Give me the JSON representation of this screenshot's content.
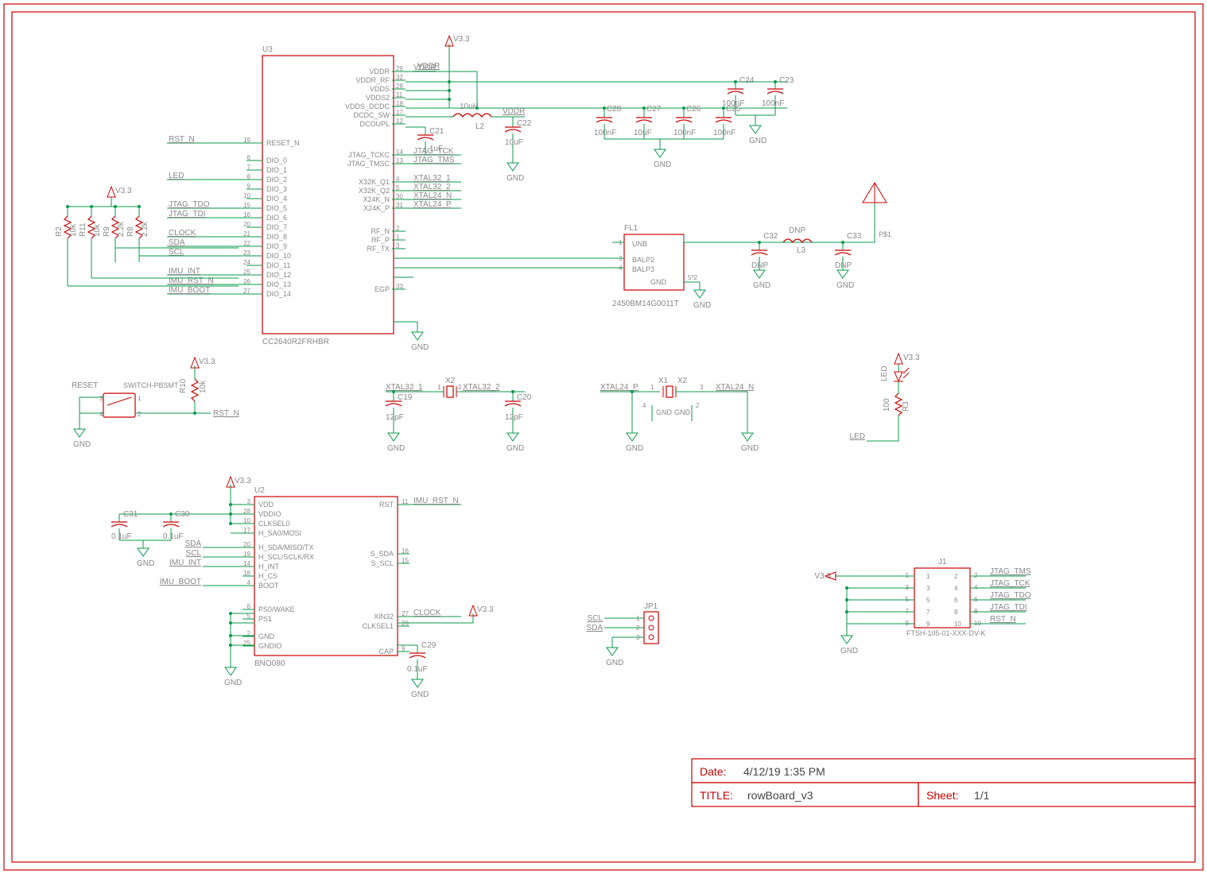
{
  "titleblock": {
    "date_label": "Date:",
    "date": "4/12/19 1:35 PM",
    "title_label": "TITLE:",
    "title": "rowBoard_v3",
    "sheet_label": "Sheet:",
    "sheet": "1/1"
  },
  "power": {
    "v33": "V3.3",
    "gnd": "GND"
  },
  "U3": {
    "ref": "U3",
    "part": "CC2640R2FRHBR",
    "pins_left": [
      {
        "num": "19",
        "name": "RESET_N",
        "net": "RST_N"
      },
      {
        "num": "6",
        "name": "DIO_0"
      },
      {
        "num": "7",
        "name": "DIO_1"
      },
      {
        "num": "8",
        "name": "DIO_2",
        "net": "LED"
      },
      {
        "num": "9",
        "name": "DIO_3"
      },
      {
        "num": "10",
        "name": "DIO_4"
      },
      {
        "num": "15",
        "name": "DIO_5",
        "net": "JTAG_TDO"
      },
      {
        "num": "16",
        "name": "DIO_6",
        "net": "JTAG_TDI"
      },
      {
        "num": "20",
        "name": "DIO_7"
      },
      {
        "num": "21",
        "name": "DIO_8",
        "net": "CLOCK"
      },
      {
        "num": "22",
        "name": "DIO_9",
        "net": "SDA"
      },
      {
        "num": "23",
        "name": "DIO_10",
        "net": "SCL"
      },
      {
        "num": "24",
        "name": "DIO_11"
      },
      {
        "num": "25",
        "name": "DIO_12",
        "net": "IMU_INT"
      },
      {
        "num": "26",
        "name": "DIO_13",
        "net": "IMU_RST_N"
      },
      {
        "num": "27",
        "name": "DIO_14",
        "net": "IMU_BOOT"
      }
    ],
    "pins_right": [
      {
        "num": "29",
        "name": "VDDR",
        "net": "VDDR"
      },
      {
        "num": "32",
        "name": "VDDR_RF"
      },
      {
        "num": "28",
        "name": "VDDS"
      },
      {
        "num": "11",
        "name": "VDDS2"
      },
      {
        "num": "18",
        "name": "VDDS_DCDC"
      },
      {
        "num": "17",
        "name": "DCDC_SW"
      },
      {
        "num": "12",
        "name": "DCOUPL"
      },
      {
        "num": "14",
        "name": "JTAG_TCKC",
        "net": "JTAG_TCK"
      },
      {
        "num": "13",
        "name": "JTAG_TMSC",
        "net": "JTAG_TMS"
      },
      {
        "num": "4",
        "name": "X32K_Q1",
        "net": "XTAL32_1"
      },
      {
        "num": "5",
        "name": "X32K_Q2",
        "net": "XTAL32_2"
      },
      {
        "num": "30",
        "name": "X24K_N",
        "net": "XTAL24_N"
      },
      {
        "num": "31",
        "name": "X24K_P",
        "net": "XTAL24_P"
      },
      {
        "num": "2",
        "name": "RF_N"
      },
      {
        "num": "1",
        "name": "RF_P"
      },
      {
        "num": "3",
        "name": "RF_TX"
      },
      {
        "num": "33",
        "name": "EGP"
      }
    ]
  },
  "U2": {
    "ref": "U2",
    "part": "BNO080",
    "pins_left": [
      {
        "num": "3",
        "name": "VDD"
      },
      {
        "num": "28",
        "name": "VDDIO"
      },
      {
        "num": "10",
        "name": "CLKSEL0"
      },
      {
        "num": "17",
        "name": "H_SA0/MOSI"
      },
      {
        "num": "20",
        "name": "H_SDA/MISO/TX",
        "net": "SDA"
      },
      {
        "num": "19",
        "name": "H_SCL/SCLK/RX",
        "net": "SCL"
      },
      {
        "num": "14",
        "name": "H_INT",
        "net": "IMU_INT"
      },
      {
        "num": "18",
        "name": "H_CS"
      },
      {
        "num": "4",
        "name": "BOOT",
        "net": "IMU_BOOT"
      },
      {
        "num": "6",
        "name": "PS0/WAKE"
      },
      {
        "num": "5",
        "name": "PS1"
      },
      {
        "num": "2",
        "name": "GND"
      },
      {
        "num": "25",
        "name": "GNDIO"
      }
    ],
    "pins_right": [
      {
        "num": "11",
        "name": "RST",
        "net": "IMU_RST_N"
      },
      {
        "num": "16",
        "name": "S_SDA"
      },
      {
        "num": "15",
        "name": "S_SCL"
      },
      {
        "num": "27",
        "name": "XIN32",
        "net": "CLOCK"
      },
      {
        "num": "26",
        "name": "CLKSEL1"
      },
      {
        "num": "9",
        "name": "CAP"
      }
    ]
  },
  "FL1": {
    "ref": "FL1",
    "part": "2450BM14G0011T",
    "pins": [
      {
        "num": "1",
        "name": "UNB"
      },
      {
        "num": "3",
        "name": "BALP2"
      },
      {
        "num": "4",
        "name": "BALP3"
      },
      {
        "num": "5*2",
        "name": "GND"
      }
    ]
  },
  "J1": {
    "ref": "J1",
    "part": "FTSH-105-01-XXX-DV-K",
    "pins": [
      "1",
      "2",
      "3",
      "4",
      "5",
      "6",
      "7",
      "8",
      "9",
      "10"
    ],
    "nets": {
      "2": "JTAG_TMS",
      "4": "JTAG_TCK",
      "6": "JTAG_TDO",
      "8": "JTAG_TDI",
      "10": "RST_N"
    }
  },
  "JP1": {
    "ref": "JP1",
    "nets": [
      "SCL",
      "SDA"
    ],
    "pins": [
      "1",
      "2",
      "3"
    ]
  },
  "switch": {
    "ref": "RESET",
    "part": "SWITCH-PBSMT",
    "pins": [
      "1",
      "2",
      "3",
      "4"
    ]
  },
  "xtals": {
    "X2": "X2",
    "X1": "X1",
    "x1_pins": {
      "1": "X1",
      "2": "X2",
      "gnd1": "4",
      "gnd2": "2",
      "p": "1",
      "n": "3"
    }
  },
  "nets": {
    "XTAL32_1": "XTAL32_1",
    "XTAL32_2": "XTAL32_2",
    "XTAL24_N": "XTAL24_N",
    "XTAL24_P": "XTAL24_P",
    "VDDR": "VDDR",
    "RST_N": "RST_N",
    "LED": "LED"
  },
  "caps": {
    "C19": {
      "ref": "C19",
      "val": "12pF"
    },
    "C20": {
      "ref": "C20",
      "val": "12pF"
    },
    "C21": {
      "ref": "C21",
      "val": "1uF"
    },
    "C22": {
      "ref": "C22",
      "val": "10uF"
    },
    "C23": {
      "ref": "C23",
      "val": "100nF"
    },
    "C24": {
      "ref": "C24",
      "val": "100nF"
    },
    "C25": {
      "ref": "C25",
      "val": "100nF"
    },
    "C26": {
      "ref": "C26",
      "val": "100nF"
    },
    "C27": {
      "ref": "C27",
      "val": "10uF"
    },
    "C28": {
      "ref": "C28",
      "val": "100nF"
    },
    "C29": {
      "ref": "C29",
      "val": "0.1uF"
    },
    "C30": {
      "ref": "C30",
      "val": "0.1uF"
    },
    "C31": {
      "ref": "C31",
      "val": "0.1uF"
    },
    "C32": {
      "ref": "C32",
      "val": "DNP"
    },
    "C33": {
      "ref": "C33",
      "val": "DNP"
    }
  },
  "inductors": {
    "L2": {
      "ref": "L2",
      "val": "10uH"
    },
    "L3": {
      "ref": "L3",
      "val": "DNP"
    }
  },
  "resistors": {
    "R2": {
      "ref": "R2",
      "val": "10k"
    },
    "R11": {
      "ref": "R11",
      "val": "10k"
    },
    "R9": {
      "ref": "R9",
      "val": "2.2k"
    },
    "R8": {
      "ref": "R8",
      "val": "2.2k"
    },
    "R10": {
      "ref": "R10",
      "val": "10k"
    },
    "R3": {
      "ref": "R3",
      "val": "100"
    }
  },
  "led": {
    "ref": "LED"
  },
  "antenna": {
    "ref": "P$1"
  },
  "netlabels_resistor_block": [
    "R2",
    "R11",
    "R9",
    "R8"
  ]
}
